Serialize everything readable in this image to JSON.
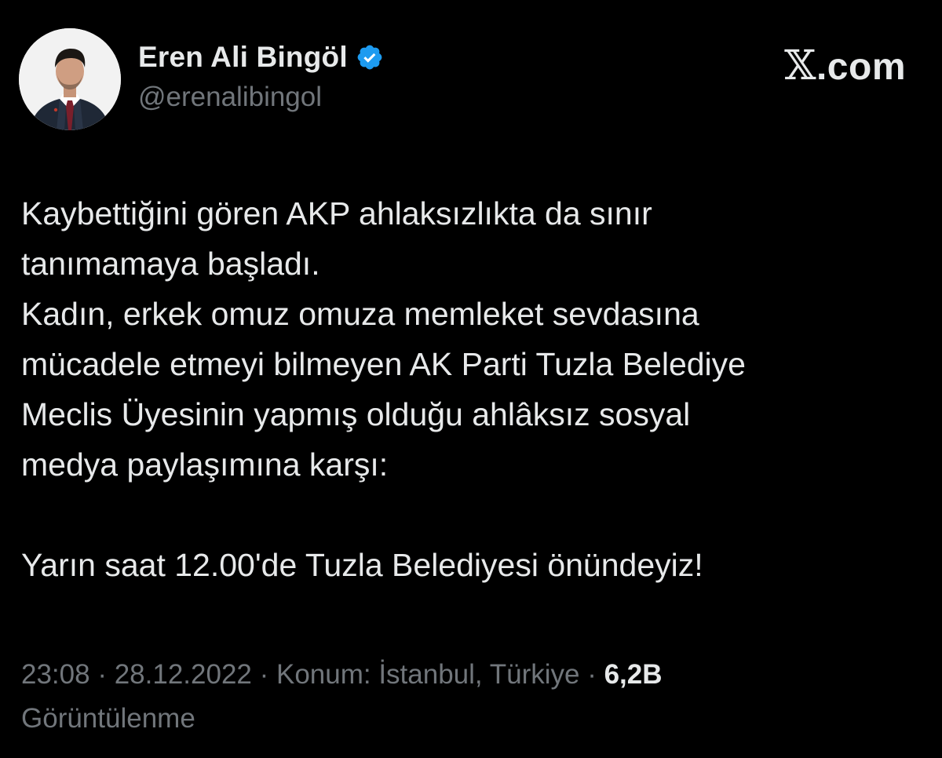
{
  "brand": {
    "x_logo": "𝕏",
    "domain": ".com"
  },
  "author": {
    "display_name": "Eren Ali Bingöl",
    "handle": "@erenalibingol",
    "verified": true,
    "avatar_icon": "avatar-photo",
    "verified_icon": "verified-badge-icon",
    "verified_color": "#1d9bf0"
  },
  "tweet": {
    "paragraph_1": "Kaybettiğini gören AKP ahlaksızlıkta da sınır\ntanımamaya başladı.\nKadın, erkek omuz omuza memleket sevdasına\nmücadele etmeyi bilmeyen AK Parti Tuzla Belediye\nMeclis Üyesinin yapmış olduğu ahlâksız sosyal\nmedya paylaşımına karşı:",
    "paragraph_2": "Yarın saat 12.00'de Tuzla Belediyesi önündeyiz!"
  },
  "meta": {
    "time": "23:08",
    "separator": " · ",
    "date": "28.12.2022",
    "location": "Konum: İstanbul, Türkiye",
    "views_count": "6,2B",
    "views_label": "Görüntülenme"
  },
  "colors": {
    "background": "#000000",
    "primary_text": "#e7e9ea",
    "secondary_text": "#71767b"
  }
}
